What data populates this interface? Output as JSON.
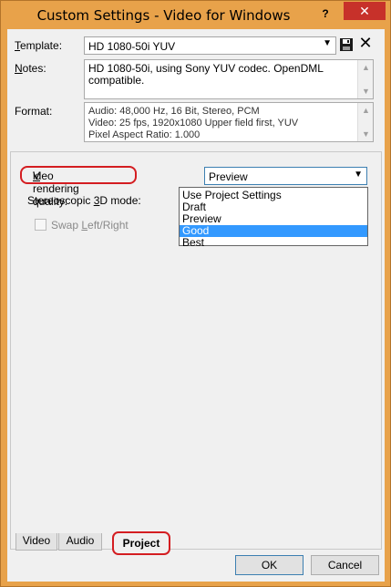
{
  "window": {
    "title": "Custom Settings - Video for Windows",
    "help_label": "?",
    "close_label": "✕"
  },
  "template": {
    "label": "Template:",
    "value": "HD 1080-50i YUV"
  },
  "notes": {
    "label": "Notes:",
    "value": "HD 1080-50i, using Sony YUV codec. OpenDML compatible."
  },
  "format": {
    "label": "Format:",
    "lines": [
      "Audio: 48,000 Hz, 16 Bit, Stereo, PCM",
      "Video: 25 fps, 1920x1080 Upper field first, YUV",
      "Pixel Aspect Ratio: 1.000"
    ]
  },
  "project": {
    "quality_label": "Video rendering quality:",
    "quality_value": "Preview",
    "quality_options": [
      "Use Project Settings",
      "Draft",
      "Preview",
      "Good",
      "Best"
    ],
    "quality_selected_index": 3,
    "stereo_label": "Stereoscopic 3D mode:",
    "swap_label": "Swap Left/Right"
  },
  "tabs": [
    "Video",
    "Audio",
    "Project"
  ],
  "active_tab": "Project",
  "buttons": {
    "ok": "OK",
    "cancel": "Cancel"
  },
  "colors": {
    "titlebar": "#e8a24a",
    "close_button": "#c7312a",
    "highlight": "#3399ff",
    "annotation": "#d41d21"
  }
}
